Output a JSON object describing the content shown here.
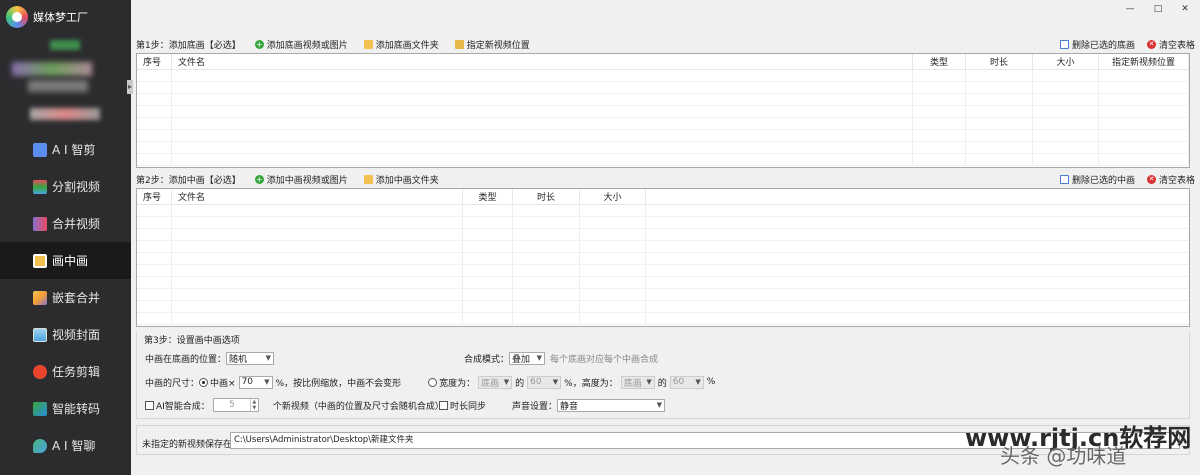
{
  "app": {
    "title": "媒体梦工厂"
  },
  "window": {
    "minimize": "—",
    "maximize": "□",
    "close": "✕"
  },
  "sidebar": {
    "items": [
      {
        "label": "A I 智剪",
        "color": "#5b8def",
        "active": false
      },
      {
        "label": "分割视频",
        "color": "#e84a5f",
        "active": false
      },
      {
        "label": "合并视频",
        "color": "#8a6fd1",
        "active": false
      },
      {
        "label": "画中画",
        "color": "#f2c14e",
        "active": true
      },
      {
        "label": "嵌套合并",
        "color": "#f29e38",
        "active": false
      },
      {
        "label": "视频封面",
        "color": "#4aa3df",
        "active": false
      },
      {
        "label": "任务剪辑",
        "color": "#e8452c",
        "active": false
      },
      {
        "label": "智能转码",
        "color": "#36a53c",
        "active": false
      },
      {
        "label": "A I 智聊",
        "color": "#4ab37f",
        "active": false
      }
    ]
  },
  "step1": {
    "label": "第1步：添加底画【必选】",
    "add_media": "添加底画视频或图片",
    "add_folder": "添加底画文件夹",
    "set_position": "指定新视频位置",
    "delete_selected": "删除已选的底画",
    "clear_table": "清空表格",
    "columns": [
      "序号",
      "文件名",
      "类型",
      "时长",
      "大小",
      "指定新视频位置"
    ]
  },
  "step2": {
    "label": "第2步：添加中画【必选】",
    "add_media": "添加中画视频或图片",
    "add_folder": "添加中画文件夹",
    "delete_selected": "删除已选的中画",
    "clear_table": "清空表格",
    "columns": [
      "序号",
      "文件名",
      "类型",
      "时长",
      "大小"
    ]
  },
  "step3": {
    "label": "第3步：设置画中画选项",
    "position_label": "中画在底画的位置：",
    "position_value": "随机",
    "blend_label": "合成模式：",
    "blend_value": "叠加",
    "blend_hint": "每个底画对应每个中画合成",
    "size_label": "中画的尺寸：",
    "size_mode_label": "中画×",
    "size_percent": "70",
    "size_hint": "%，按比例缩放，中画不会变形",
    "width_label": "宽度为：",
    "width_ref": "底画",
    "of": "的",
    "width_value": "60",
    "percent_comma": "%，",
    "height_label": "高度为：",
    "height_ref": "底画",
    "height_value": "60",
    "percent": "%",
    "ai_label": "AI智能合成：",
    "ai_count": "5",
    "ai_hint": "个新视频（中画的位置及尺寸会随机合成）",
    "sync_label": "时长同步",
    "audio_label": "声音设置：",
    "audio_value": "静音"
  },
  "output": {
    "label": "未指定的新视频保存在：",
    "path": "C:\\Users\\Administrator\\Desktop\\新建文件夹"
  },
  "watermark": {
    "url": "www.rjtj.cn软荐网",
    "text": "头条 @功味道"
  }
}
